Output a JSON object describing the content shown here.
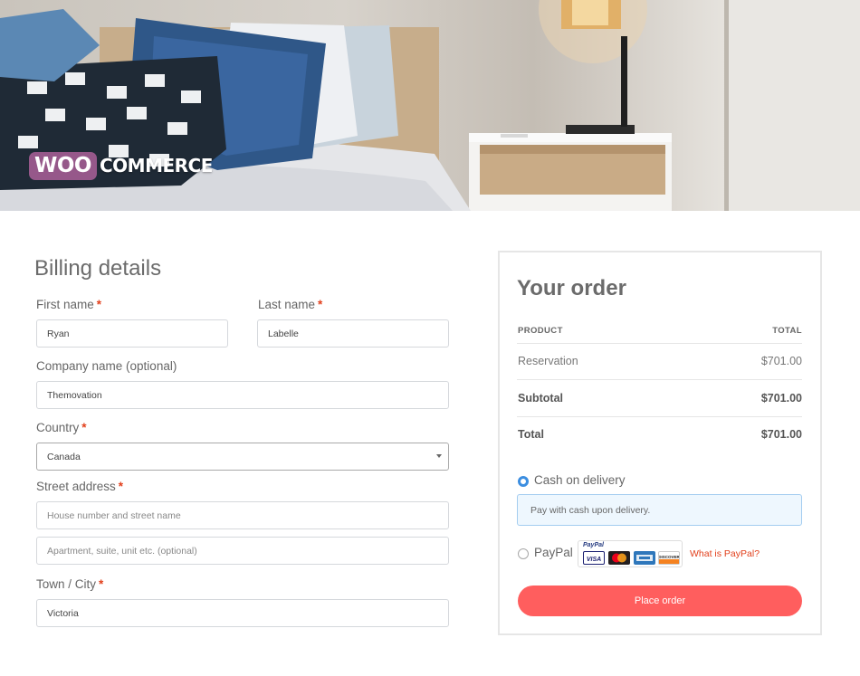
{
  "brand": {
    "logo_text": "WOOCOMMERCE"
  },
  "billing": {
    "title": "Billing details",
    "first_name": {
      "label": "First name",
      "value": "Ryan"
    },
    "last_name": {
      "label": "Last name",
      "value": "Labelle"
    },
    "company": {
      "label": "Company name (optional)",
      "value": "Themovation"
    },
    "country": {
      "label": "Country",
      "value": "Canada"
    },
    "street": {
      "label": "Street address",
      "placeholder1": "House number and street name",
      "placeholder2": "Apartment, suite, unit etc. (optional)"
    },
    "city": {
      "label": "Town / City",
      "value": "Victoria"
    },
    "required_mark": "*"
  },
  "order": {
    "title": "Your order",
    "col_product": "PRODUCT",
    "col_total": "TOTAL",
    "rows": [
      {
        "label": "Reservation",
        "value": "$701.00"
      },
      {
        "label": "Subtotal",
        "value": "$701.00"
      },
      {
        "label": "Total",
        "value": "$701.00"
      }
    ],
    "payment": {
      "cod_label": "Cash on delivery",
      "cod_desc": "Pay with cash upon delivery.",
      "paypal_label": "PayPal",
      "paypal_logo_text": "PayPal",
      "what_is_paypal": "What is PayPal?",
      "card_brands": [
        "VISA",
        "MasterCard",
        "AMEX",
        "DISCOVER"
      ]
    },
    "place_order": "Place order"
  },
  "colors": {
    "accent_red": "#ff5e5e",
    "required_red": "#e2401c",
    "radio_blue": "#3c8ee0",
    "woo_purple": "#96588a"
  }
}
